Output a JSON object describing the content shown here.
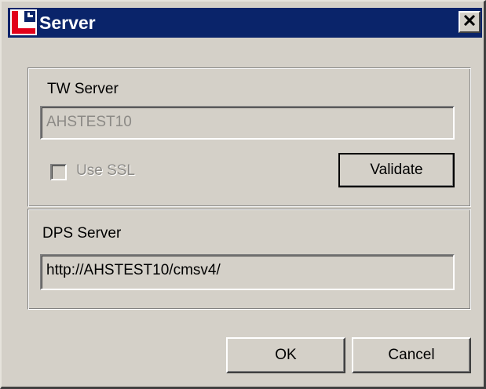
{
  "window": {
    "title": "Server",
    "app_icon": "red-app-logo-icon",
    "close_icon": "close-x-icon"
  },
  "tw_server": {
    "label": "TW Server",
    "value": "AHSTEST10",
    "use_ssl_label": "Use SSL",
    "use_ssl_checked": false,
    "validate_label": "Validate"
  },
  "dps_server": {
    "label": "DPS Server",
    "value": "http://AHSTEST10/cmsv4/"
  },
  "buttons": {
    "ok": "OK",
    "cancel": "Cancel"
  },
  "colors": {
    "titlebar": "#0a246a",
    "face": "#d4d0c8",
    "icon_red": "#e2001a"
  }
}
